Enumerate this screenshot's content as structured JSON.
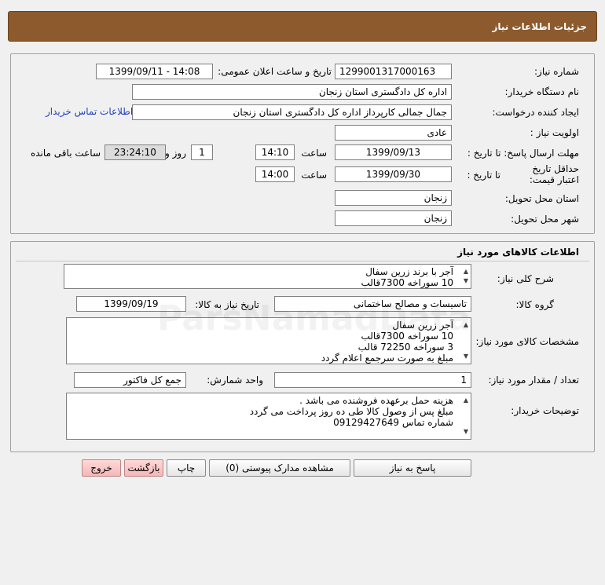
{
  "header": {
    "title": "جزئیات اطلاعات نیاز"
  },
  "info": {
    "need_number_label": "شماره نیاز:",
    "need_number": "1299001317000163",
    "announce_label": "تاریخ و ساعت اعلان عمومی:",
    "announce_value": "1399/09/11 - 14:08",
    "buyer_org_label": "نام دستگاه خریدار:",
    "buyer_org": "اداره کل دادگستری استان زنجان",
    "creator_label": "ایجاد کننده درخواست:",
    "creator": "جمال جمالی کارپرداز اداره کل دادگستری استان زنجان",
    "contact_link": "اطلاعات تماس خریدار",
    "priority_label": "اولویت نیاز :",
    "priority": "عادی",
    "deadline_label": "مهلت ارسال پاسخ: تا تاریخ :",
    "deadline_date": "1399/09/13",
    "time_label": "ساعت",
    "deadline_time": "14:10",
    "days_value": "1",
    "days_label": "روز و",
    "remaining_time": "23:24:10",
    "remaining_label": "ساعت باقی مانده",
    "validity_label": "حداقل تاریخ اعتبار قیمت:",
    "validity_to_label": "تا تاریخ :",
    "validity_date": "1399/09/30",
    "validity_time_label": "ساعت",
    "validity_time": "14:00",
    "province_label": "استان محل تحویل:",
    "province": "زنجان",
    "city_label": "شهر محل تحویل:",
    "city": "زنجان"
  },
  "goods": {
    "section_title": "اطلاعات کالاهای مورد نیاز",
    "summary_label": "شرح کلی نیاز:",
    "summary_lines": [
      "آجر با برند  زرین سفال",
      "10  سوراخه 7300قالب"
    ],
    "group_label": "گروه کالا:",
    "group": "تاسیسات و مصالح ساختمانی",
    "need_date_label": "تاریخ نیاز به کالا:",
    "need_date": "1399/09/19",
    "specs_label": "مشخصات کالای مورد نیاز:",
    "specs_lines": [
      "آجر زرین سفال",
      "10  سوراخه 7300قالب",
      "3 سوراخه 72250 قالب",
      "مبلغ به صورت سرجمع اعلام گردد"
    ],
    "qty_label": "تعداد / مقدار مورد نیاز:",
    "qty": "1",
    "unit_label": "واحد شمارش:",
    "unit": "جمع کل فاکتور",
    "buyer_notes_label": "توضیحات خریدار:",
    "buyer_notes_lines": [
      "هزینه حمل برعهده فروشنده می باشد .",
      "مبلغ پس از وصول کالا طی ده روز پرداخت می گردد",
      "شماره تماس 09129427649"
    ]
  },
  "buttons": {
    "reply": "پاسخ به نیاز",
    "attachments": "مشاهده مدارک پیوستی (0)",
    "print": "چاپ",
    "back": "بازگشت",
    "exit": "خروج"
  },
  "watermark": {
    "text": "ParsNamadData"
  }
}
